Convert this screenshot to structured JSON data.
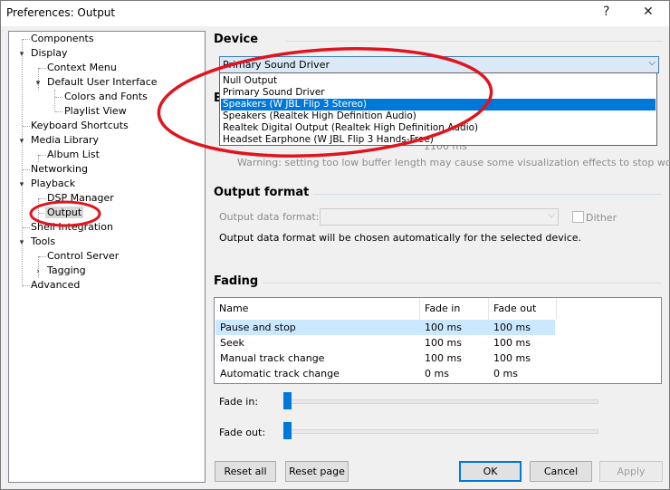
{
  "window": {
    "title": "Preferences: Output",
    "help_glyph": "?",
    "close_glyph": "✕"
  },
  "tree": {
    "items": [
      {
        "label": "Components"
      },
      {
        "label": "Display"
      },
      {
        "label": "Context Menu"
      },
      {
        "label": "Default User Interface"
      },
      {
        "label": "Colors and Fonts"
      },
      {
        "label": "Playlist View"
      },
      {
        "label": "Keyboard Shortcuts"
      },
      {
        "label": "Media Library"
      },
      {
        "label": "Album List"
      },
      {
        "label": "Networking"
      },
      {
        "label": "Playback"
      },
      {
        "label": "DSP Manager"
      },
      {
        "label": "Output"
      },
      {
        "label": "Shell Integration"
      },
      {
        "label": "Tools"
      },
      {
        "label": "Control Server"
      },
      {
        "label": "Tagging"
      },
      {
        "label": "Advanced"
      }
    ],
    "selected": "Output"
  },
  "device": {
    "heading": "Device",
    "selected": "Primary Sound Driver",
    "options": [
      "Null Output",
      "Primary Sound Driver",
      "Speakers (W JBL Flip 3 Stereo)",
      "Speakers (Realtek High Definition Audio)",
      "Realtek Digital Output (Realtek High Definition Audio)",
      "Headset Earphone (W JBL Flip 3 Hands-Free)"
    ],
    "highlighted": "Speakers (W JBL Flip 3 Stereo)"
  },
  "buffer": {
    "heading_partial": "B",
    "value_partial": "1100 ms",
    "warning": "Warning: setting too low buffer length may cause some visualization effects to stop working."
  },
  "output_format": {
    "heading": "Output format",
    "label": "Output data format:",
    "dither_label": "Dither",
    "dither_checked": false,
    "note": "Output data format will be chosen automatically for the selected device."
  },
  "fading": {
    "heading": "Fading",
    "columns": [
      "Name",
      "Fade in",
      "Fade out"
    ],
    "rows": [
      {
        "name": "Pause and stop",
        "fade_in": "100 ms",
        "fade_out": "100 ms"
      },
      {
        "name": "Seek",
        "fade_in": "100 ms",
        "fade_out": "100 ms"
      },
      {
        "name": "Manual track change",
        "fade_in": "100 ms",
        "fade_out": "100 ms"
      },
      {
        "name": "Automatic track change",
        "fade_in": "0 ms",
        "fade_out": "0 ms"
      }
    ],
    "fade_in_label": "Fade in:",
    "fade_out_label": "Fade out:",
    "fade_in_level": 0,
    "fade_out_level": 0
  },
  "buttons": {
    "reset_all": "Reset all",
    "reset_page": "Reset page",
    "ok": "OK",
    "cancel": "Cancel",
    "apply": "Apply"
  },
  "colors": {
    "accent": "#0078d7",
    "annotation": "#e0141e",
    "selected_row": "#cce8ff"
  }
}
